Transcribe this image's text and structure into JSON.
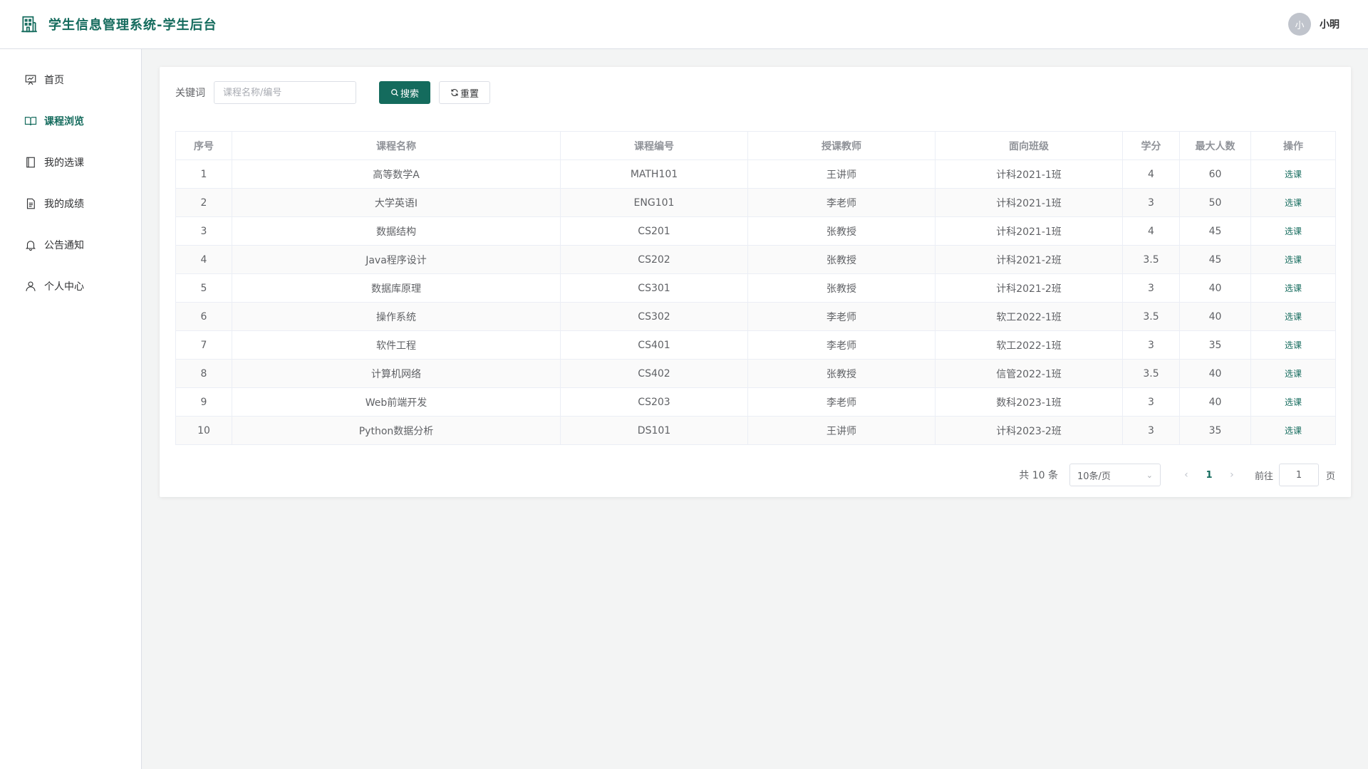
{
  "app": {
    "title": "学生信息管理系统-学生后台",
    "user": {
      "avatar_text": "小",
      "name": "小明"
    }
  },
  "sidebar": {
    "items": [
      {
        "label": "首页",
        "icon": "presentation-icon",
        "active": false
      },
      {
        "label": "课程浏览",
        "icon": "book-icon",
        "active": true
      },
      {
        "label": "我的选课",
        "icon": "notebook-icon",
        "active": false
      },
      {
        "label": "我的成绩",
        "icon": "document-icon",
        "active": false
      },
      {
        "label": "公告通知",
        "icon": "bell-icon",
        "active": false
      },
      {
        "label": "个人中心",
        "icon": "user-icon",
        "active": false
      }
    ]
  },
  "search": {
    "label": "关键词",
    "placeholder": "课程名称/编号",
    "value": "",
    "search_button": "搜索",
    "reset_button": "重置"
  },
  "table": {
    "headers": [
      "序号",
      "课程名称",
      "课程编号",
      "授课教师",
      "面向班级",
      "学分",
      "最大人数",
      "操作"
    ],
    "rows": [
      [
        "1",
        "高等数学A",
        "MATH101",
        "王讲师",
        "计科2021-1班",
        "4",
        "60",
        "选课"
      ],
      [
        "2",
        "大学英语I",
        "ENG101",
        "李老师",
        "计科2021-1班",
        "3",
        "50",
        "选课"
      ],
      [
        "3",
        "数据结构",
        "CS201",
        "张教授",
        "计科2021-1班",
        "4",
        "45",
        "选课"
      ],
      [
        "4",
        "Java程序设计",
        "CS202",
        "张教授",
        "计科2021-2班",
        "3.5",
        "45",
        "选课"
      ],
      [
        "5",
        "数据库原理",
        "CS301",
        "张教授",
        "计科2021-2班",
        "3",
        "40",
        "选课"
      ],
      [
        "6",
        "操作系统",
        "CS302",
        "李老师",
        "软工2022-1班",
        "3.5",
        "40",
        "选课"
      ],
      [
        "7",
        "软件工程",
        "CS401",
        "李老师",
        "软工2022-1班",
        "3",
        "35",
        "选课"
      ],
      [
        "8",
        "计算机网络",
        "CS402",
        "张教授",
        "信管2022-1班",
        "3.5",
        "40",
        "选课"
      ],
      [
        "9",
        "Web前端开发",
        "CS203",
        "李老师",
        "数科2023-1班",
        "3",
        "40",
        "选课"
      ],
      [
        "10",
        "Python数据分析",
        "DS101",
        "王讲师",
        "计科2023-2班",
        "3",
        "35",
        "选课"
      ]
    ]
  },
  "pagination": {
    "total": "共 10 条",
    "page_size": "10条/页",
    "current_page": "1",
    "goto_label": "前往",
    "goto_value": "1",
    "page_suffix": "页"
  },
  "colors": {
    "accent": "#146b5d",
    "background": "#f3f4f4"
  }
}
